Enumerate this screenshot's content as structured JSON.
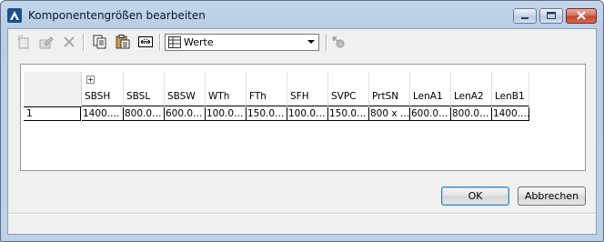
{
  "window": {
    "title": "Komponentengrößen bearbeiten"
  },
  "toolbar": {
    "buttons": [
      {
        "name": "new-row-icon"
      },
      {
        "name": "edit-icon"
      },
      {
        "name": "delete-icon"
      },
      {
        "name": "copy-icon"
      },
      {
        "name": "paste-icon"
      },
      {
        "name": "column-width-icon"
      },
      {
        "name": "settings-icon"
      }
    ],
    "view_select": {
      "value": "Werte",
      "icon": "table-icon"
    }
  },
  "grid": {
    "columns": [
      "SBSH",
      "SBSL",
      "SBSW",
      "WTh",
      "FTh",
      "SFH",
      "SVPC",
      "PrtSN",
      "LenA1",
      "LenA2",
      "LenB1"
    ],
    "rows": [
      {
        "index": "1",
        "cells": [
          "1400.…",
          "800.0…",
          "600.0…",
          "100.0…",
          "150.0…",
          "100.0…",
          "150.0…",
          "800 x …",
          "600.0…",
          "800.0…",
          "1400.…"
        ]
      }
    ]
  },
  "buttons": {
    "ok": "OK",
    "cancel": "Abbrechen"
  },
  "colors": {
    "title_bar": "#b9cde6",
    "accent_border": "#3c7fb1"
  }
}
